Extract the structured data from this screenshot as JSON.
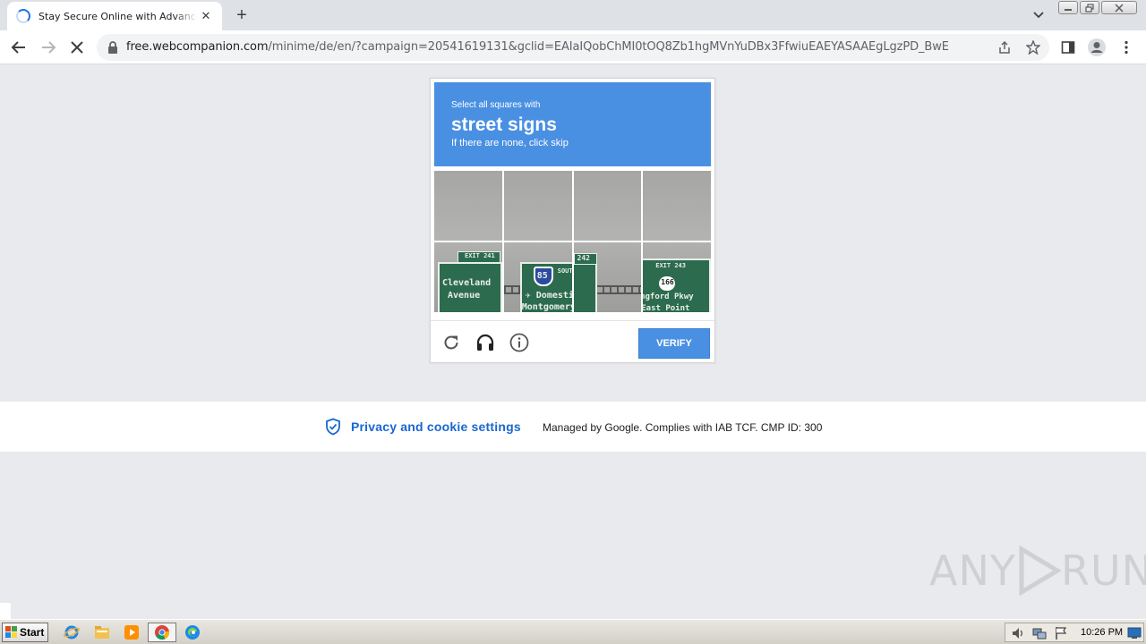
{
  "browser": {
    "tab_title": "Stay Secure Online with Advanced Antivirus",
    "tab_close": "✕",
    "new_tab": "+",
    "url_host": "free.webcompanion.com",
    "url_path": "/minime/de/en/?campaign=20541619131&gclid=EAIaIQobChMI0tOQ8Zb1hgMVnYuDBx3FfwiuEAEYASAAEgLgzPD_BwE"
  },
  "captcha": {
    "instruction": "Select all squares with",
    "target": "street signs",
    "hint": "If there are none, click skip",
    "verify_label": "VERIFY",
    "signs": [
      {
        "exit": "EXIT 241",
        "line1": "Cleveland",
        "line2": "Avenue"
      },
      {
        "shield": "85",
        "dir": "SOUTH",
        "line1": "✈ Domestic",
        "line2": "Montgomery"
      },
      {
        "exit": "242"
      },
      {
        "exit": "EXIT 243",
        "shield": "166",
        "line1": "Langford Pkwy",
        "line2": "East Point"
      }
    ]
  },
  "consent": {
    "privacy_label": "Privacy and cookie settings",
    "managed_text": "Managed by Google. Complies with IAB TCF. CMP ID: 300"
  },
  "watermark": {
    "left": "ANY",
    "right": "RUN"
  },
  "taskbar": {
    "start_label": "Start",
    "clock": "10:26 PM"
  }
}
